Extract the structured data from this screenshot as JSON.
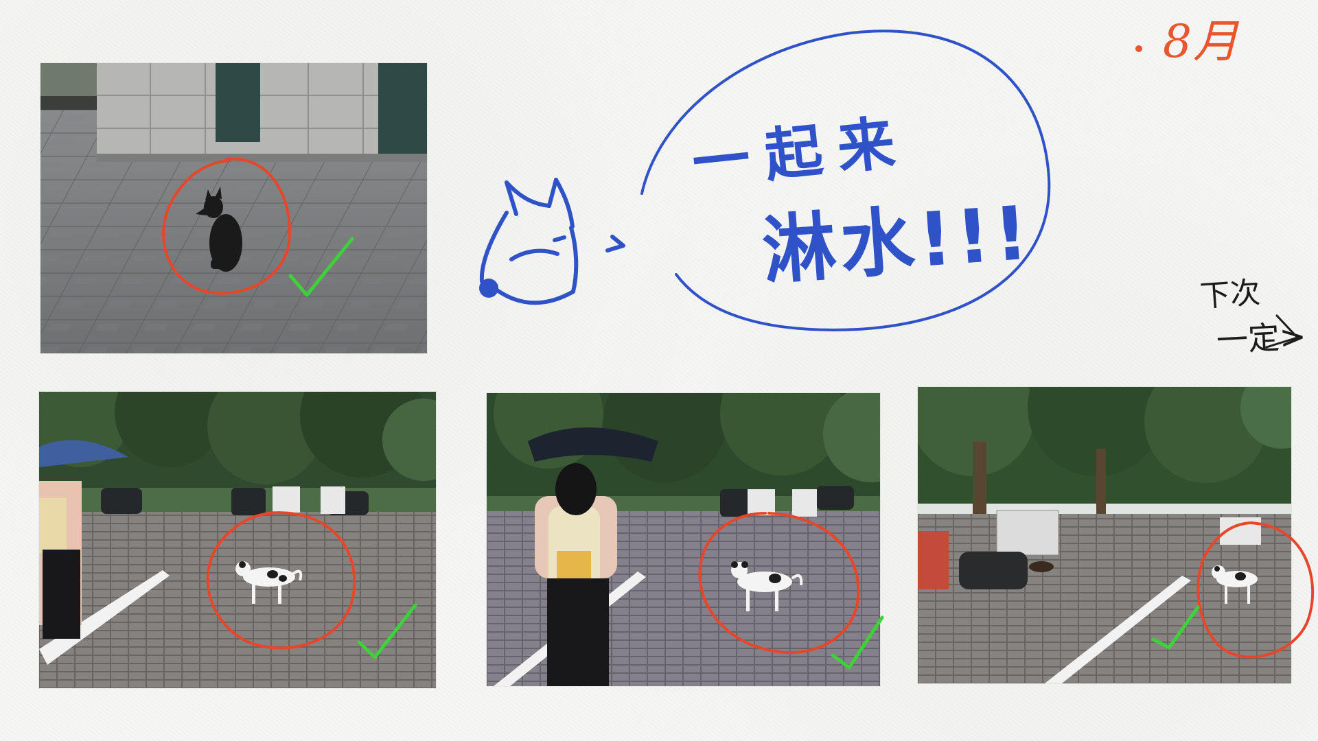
{
  "annotations": {
    "month": "8月",
    "bubble_line1": "一起来",
    "bubble_line2": "淋水!!!",
    "note_line1": "下次",
    "note_line2": "一定>"
  },
  "colors": {
    "circle": "#e8462a",
    "check": "#3fd13a",
    "bubble_ink": "#2f52c9",
    "month_ink": "#e8562e",
    "note_ink": "#1c1c1c"
  },
  "photos": [
    {
      "subject": "black-dog-sitting-plaza"
    },
    {
      "subject": "white-dog-parking-lot-umbrella"
    },
    {
      "subject": "white-dog-standing-parking-lot"
    },
    {
      "subject": "white-dog-trees-parking-lot"
    }
  ]
}
